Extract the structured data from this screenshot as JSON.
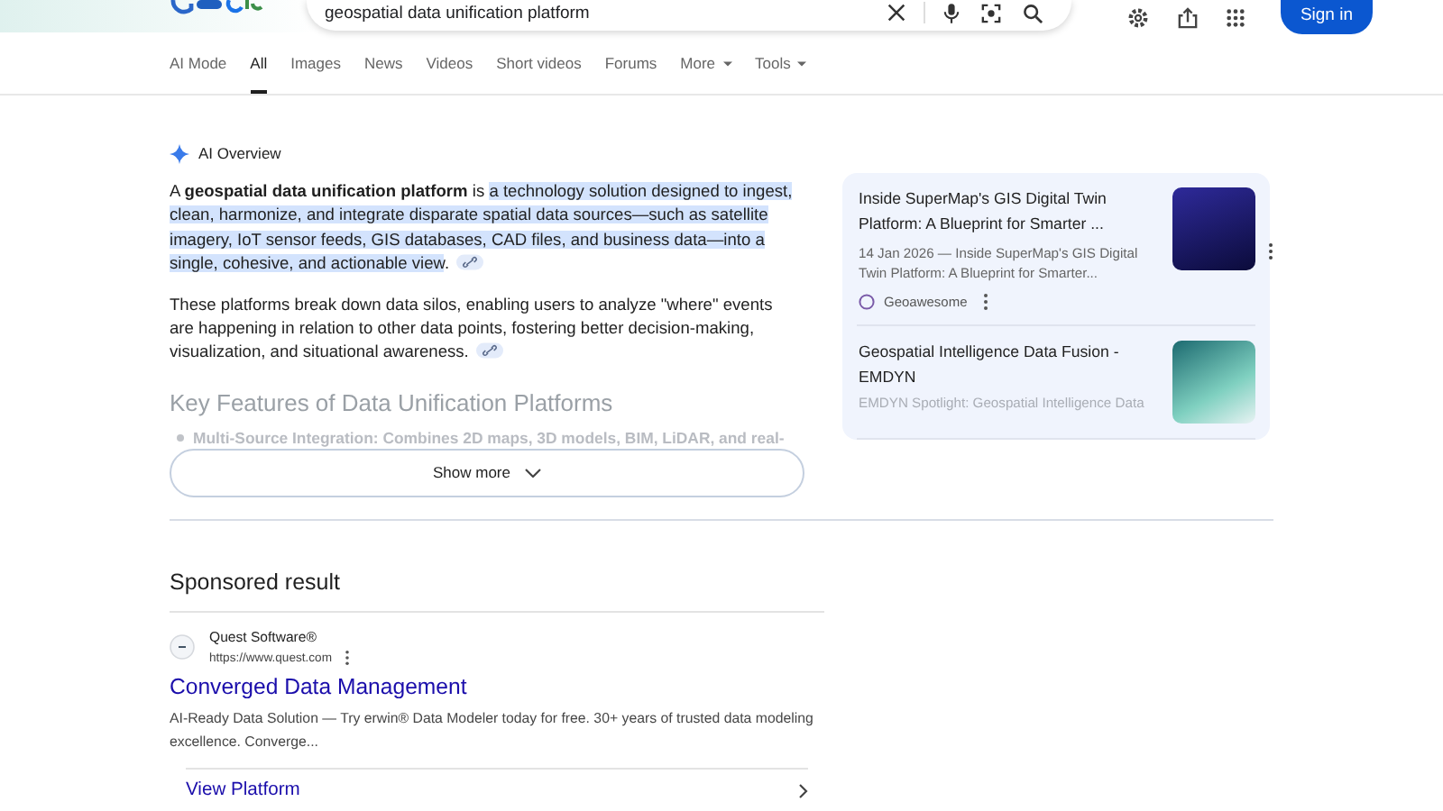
{
  "header": {
    "query": "geospatial data unification platform",
    "sign_in": "Sign in"
  },
  "tabs": [
    {
      "label": "AI Mode",
      "selected": false,
      "menu": false
    },
    {
      "label": "All",
      "selected": true,
      "menu": false
    },
    {
      "label": "Images",
      "selected": false,
      "menu": false
    },
    {
      "label": "News",
      "selected": false,
      "menu": false
    },
    {
      "label": "Videos",
      "selected": false,
      "menu": false
    },
    {
      "label": "Short videos",
      "selected": false,
      "menu": false
    },
    {
      "label": "Forums",
      "selected": false,
      "menu": false
    },
    {
      "label": "More",
      "selected": false,
      "menu": true
    },
    {
      "label": "Tools",
      "selected": false,
      "menu": true
    }
  ],
  "ai_overview": {
    "label": "AI Overview",
    "paragraphs": [
      [
        {
          "text": "A **geospatial data unification platform** is ",
          "highlighted": false
        },
        {
          "text": "a technology solution designed to ingest, clean, harmonize, and integrate disparate spatial data sources—such as satellite imagery, IoT sensor feeds, GIS databases, CAD files, and business data—into a single, cohesive, and actionable view",
          "highlighted": true
        },
        {
          "text": ".",
          "highlighted": false
        }
      ],
      [
        {
          "text": "These platforms break down data silos, enabling users to analyze \"where\" events are happening in relation to other data points, fostering better decision-making, visualization, and situational awareness.",
          "highlighted": false
        }
      ]
    ],
    "heading": "Key Features of Data Unification Platforms",
    "faded_bullet": "Multi-Source Integration: Combines 2D maps, 3D models, BIM, LiDAR, and real-",
    "show_more": "Show more",
    "sources": [
      {
        "title": "Inside SuperMap's GIS Digital Twin Platform: A Blueprint for Smarter ...",
        "snippet": "14 Jan 2026 — Inside SuperMap's GIS Digital Twin Platform: A Blueprint for Smarter...",
        "site": "Geoawesome",
        "kind": "dark"
      },
      {
        "title": "Geospatial Intelligence Data Fusion - EMDYN",
        "snippet": "EMDYN Spotlight: Geospatial Intelligence Data",
        "kind": "teal"
      }
    ]
  },
  "sponsored": {
    "heading": "Sponsored result",
    "advertiser": "Quest Software®",
    "url": "https://www.quest.com",
    "title": "Converged Data Management",
    "description": "AI-Ready Data Solution — Try erwin® Data Modeler today for free. 30+ years of trusted data modeling excellence. Converge...",
    "sitelink": "View Platform"
  }
}
